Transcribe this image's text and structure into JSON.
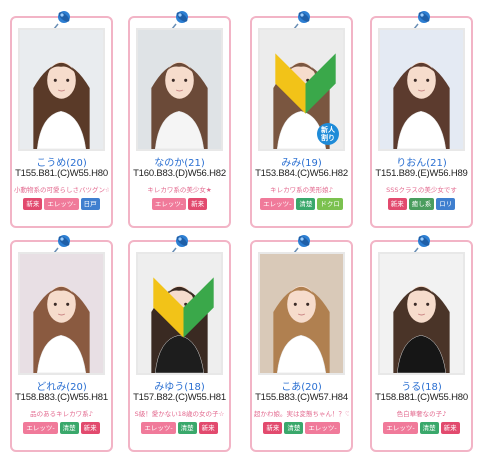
{
  "cards": [
    {
      "name": "こうめ(20)",
      "stats": "T155.B81.(C)W55.H80",
      "catch": "小動物系の可愛らしさバツグン☆",
      "tags": [
        {
          "label": "新来",
          "color": "#e24a6e"
        },
        {
          "label": "エレッツ-",
          "color": "#f07a9a"
        },
        {
          "label": "日戸",
          "color": "#3f7fcf"
        }
      ],
      "new": false,
      "leaf": false,
      "hair": "#5a3a28",
      "shirt": "#ffffff",
      "bg": "#e9ecef"
    },
    {
      "name": "なのか(21)",
      "stats": "T160.B83.(D)W56.H82",
      "catch": "キレカワ系の美少女★",
      "tags": [
        {
          "label": "エレッツ-",
          "color": "#f07a9a"
        },
        {
          "label": "新来",
          "color": "#e24a6e"
        }
      ],
      "new": false,
      "leaf": false,
      "hair": "#6b4a38",
      "shirt": "#f5f5f5",
      "bg": "#dfe3e6"
    },
    {
      "name": "みみ(19)",
      "stats": "T153.B84.(C)W56.H82",
      "catch": "キレカワ系の美形娘♪",
      "tags": [
        {
          "label": "エレッツ-",
          "color": "#f07a9a"
        },
        {
          "label": "清楚",
          "color": "#3aa86b"
        },
        {
          "label": "ドクロ",
          "color": "#7bc14f"
        }
      ],
      "new": true,
      "leaf": true,
      "hair": "#7a5640",
      "shirt": "#ffffff",
      "bg": "#ececec"
    },
    {
      "name": "りおん(21)",
      "stats": "T151.B89.(E)W56.H89",
      "catch": "SSSクラスの美少女です",
      "tags": [
        {
          "label": "新来",
          "color": "#e24a6e"
        },
        {
          "label": "癒し系",
          "color": "#4a9d5e"
        },
        {
          "label": "ロリ",
          "color": "#3f7fcf"
        }
      ],
      "new": false,
      "leaf": false,
      "hair": "#5c3b2e",
      "shirt": "#ffffff",
      "bg": "#e4eaf3"
    },
    {
      "name": "どれみ(20)",
      "stats": "T158.B83.(C)W55.H81",
      "catch": "品のあるキレカワ系♪",
      "tags": [
        {
          "label": "エレッツ-",
          "color": "#f07a9a"
        },
        {
          "label": "清楚",
          "color": "#3aa86b"
        },
        {
          "label": "新来",
          "color": "#e24a6e"
        }
      ],
      "new": false,
      "leaf": false,
      "hair": "#8a5a40",
      "shirt": "#ffffff",
      "bg": "#e8dfe4"
    },
    {
      "name": "みゆう(18)",
      "stats": "T157.B82.(C)W55.H81",
      "catch": "S級！愛かない18歳の女の子☆",
      "tags": [
        {
          "label": "エレッツ-",
          "color": "#f07a9a"
        },
        {
          "label": "清楚",
          "color": "#3aa86b"
        },
        {
          "label": "新来",
          "color": "#e24a6e"
        }
      ],
      "new": false,
      "leaf": true,
      "hair": "#3a2a22",
      "shirt": "#1d1d1d",
      "bg": "#eeeeee"
    },
    {
      "name": "こあ(20)",
      "stats": "T155.B83.(C)W57.H84",
      "catch": "超かわ娘。実は変態ちゃん！？♡",
      "tags": [
        {
          "label": "新来",
          "color": "#e24a6e"
        },
        {
          "label": "清楚",
          "color": "#3aa86b"
        },
        {
          "label": "エレッツ-",
          "color": "#f07a9a"
        }
      ],
      "new": false,
      "leaf": false,
      "hair": "#b08050",
      "shirt": "#ffffff",
      "bg": "#d9c9b8"
    },
    {
      "name": "うる(18)",
      "stats": "T158.B81.(C)W55.H80",
      "catch": "色白華奢なの子♪",
      "tags": [
        {
          "label": "エレッツ-",
          "color": "#f07a9a"
        },
        {
          "label": "清楚",
          "color": "#3aa86b"
        },
        {
          "label": "新来",
          "color": "#e24a6e"
        }
      ],
      "new": false,
      "leaf": false,
      "hair": "#4a3428",
      "shirt": "#161616",
      "bg": "#f2f2f2"
    }
  ]
}
